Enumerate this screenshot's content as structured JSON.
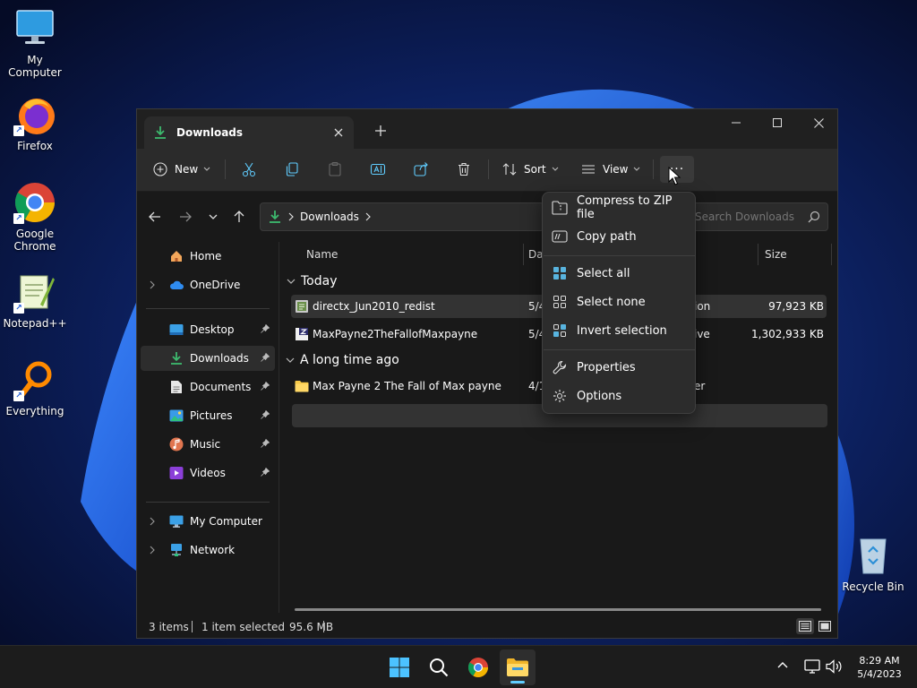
{
  "desktop": {
    "icons": [
      {
        "label": "My Computer",
        "icon": "monitor-icon"
      },
      {
        "label": "Firefox",
        "icon": "firefox-icon"
      },
      {
        "label": "Google Chrome",
        "icon": "chrome-icon"
      },
      {
        "label": "Notepad++",
        "icon": "notepadpp-icon"
      },
      {
        "label": "Everything",
        "icon": "everything-icon"
      },
      {
        "label": "Recycle Bin",
        "icon": "recycle-bin-icon"
      }
    ]
  },
  "window": {
    "tab_title": "Downloads",
    "toolbar": {
      "new_label": "New",
      "sort_label": "Sort",
      "view_label": "View",
      "more_label": "···"
    },
    "breadcrumb": [
      "Downloads"
    ],
    "search_placeholder": "Search Downloads",
    "sidebar": {
      "top": [
        {
          "label": "Home",
          "icon": "home-icon"
        },
        {
          "label": "OneDrive",
          "icon": "cloud-icon"
        }
      ],
      "quick": [
        {
          "label": "Desktop",
          "icon": "desktop-folder-icon"
        },
        {
          "label": "Downloads",
          "icon": "download-icon"
        },
        {
          "label": "Documents",
          "icon": "documents-icon"
        },
        {
          "label": "Pictures",
          "icon": "pictures-icon"
        },
        {
          "label": "Music",
          "icon": "music-icon"
        },
        {
          "label": "Videos",
          "icon": "videos-icon"
        }
      ],
      "bottom": [
        {
          "label": "My Computer",
          "icon": "computer-icon"
        },
        {
          "label": "Network",
          "icon": "network-icon"
        }
      ]
    },
    "columns": {
      "name": "Name",
      "date": "Da",
      "size": "Size"
    },
    "groups": [
      {
        "label": "Today",
        "items": [
          {
            "name": "directx_Jun2010_redist",
            "date": "5/4",
            "type": "ion",
            "size": "97,923 KB",
            "icon": "installer-icon"
          },
          {
            "name": "MaxPayne2TheFallofMaxpayne",
            "date": "5/4",
            "type": "ive",
            "size": "1,302,933 KB",
            "icon": "archive-icon"
          }
        ]
      },
      {
        "label": "A long time ago",
        "items": [
          {
            "name": "Max Payne 2 The Fall of Max payne",
            "date": "4/1",
            "type": "er",
            "size": "",
            "icon": "folder-icon"
          }
        ]
      }
    ],
    "status": {
      "count": "3 items",
      "selection": "1 item selected",
      "size": "95.6 MB"
    }
  },
  "context_menu": {
    "items": [
      {
        "label": "Compress to ZIP file",
        "icon": "zip-icon"
      },
      {
        "label": "Copy path",
        "icon": "copy-path-icon"
      },
      {
        "label": "Select all",
        "icon": "select-all-icon"
      },
      {
        "label": "Select none",
        "icon": "select-none-icon"
      },
      {
        "label": "Invert selection",
        "icon": "invert-selection-icon"
      },
      {
        "label": "Properties",
        "icon": "wrench-icon"
      },
      {
        "label": "Options",
        "icon": "gear-icon"
      }
    ]
  },
  "taskbar": {
    "apps": [
      "start-icon",
      "search-icon",
      "chrome-icon",
      "file-explorer-icon"
    ],
    "clock": {
      "time": "8:29 AM",
      "date": "5/4/2023"
    }
  },
  "colors": {
    "accent": "#60cdff",
    "download_green": "#3dba6e",
    "folder_yellow": "#f7c948"
  }
}
